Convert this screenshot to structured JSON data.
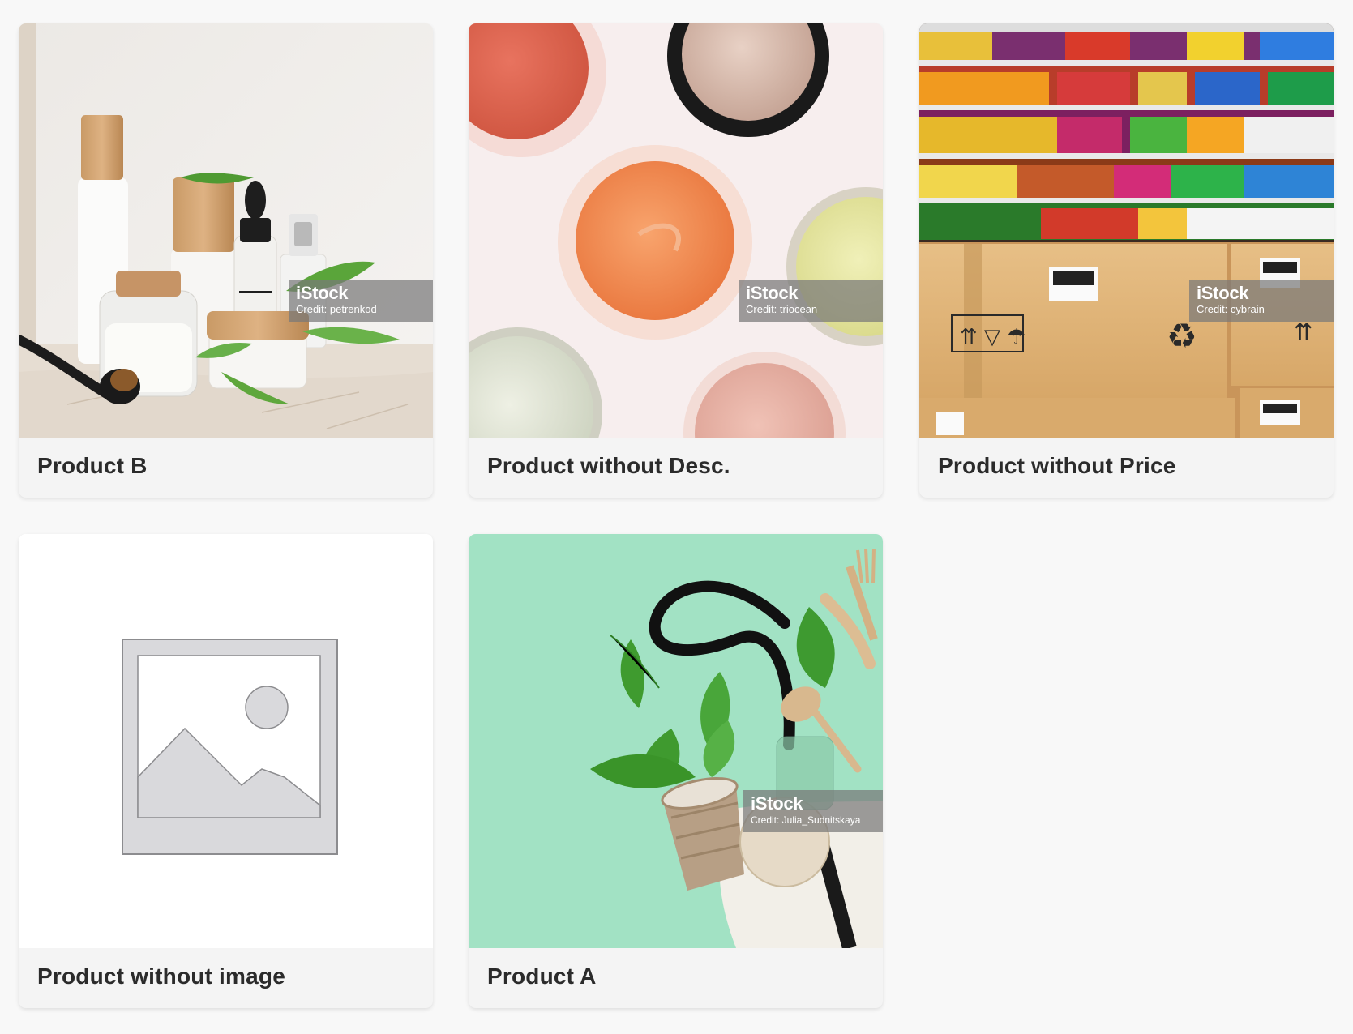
{
  "products": [
    {
      "title": "Product B",
      "image_label": "cosmetics bottles photo",
      "watermark": {
        "brand": "iStock",
        "credit": "Credit: petrenkod"
      }
    },
    {
      "title": "Product without Desc.",
      "image_label": "cosmetic jars photo",
      "watermark": {
        "brand": "iStock",
        "credit": "Credit: triocean"
      }
    },
    {
      "title": "Product without Price",
      "image_label": "warehouse boxes photo",
      "watermark": {
        "brand": "iStock",
        "credit": "Credit: cybrain"
      }
    },
    {
      "title": "Product without image",
      "image_label": "placeholder image"
    },
    {
      "title": "Product A",
      "image_label": "eco bag photo",
      "watermark": {
        "brand": "iStock",
        "credit": "Credit: Julia_Sudnitskaya"
      }
    }
  ],
  "colors": {
    "page_background": "#f8f8f8",
    "card_background": "#f4f4f4",
    "title_text": "#2b2b2b",
    "mint_background": "#9fe0c0"
  }
}
